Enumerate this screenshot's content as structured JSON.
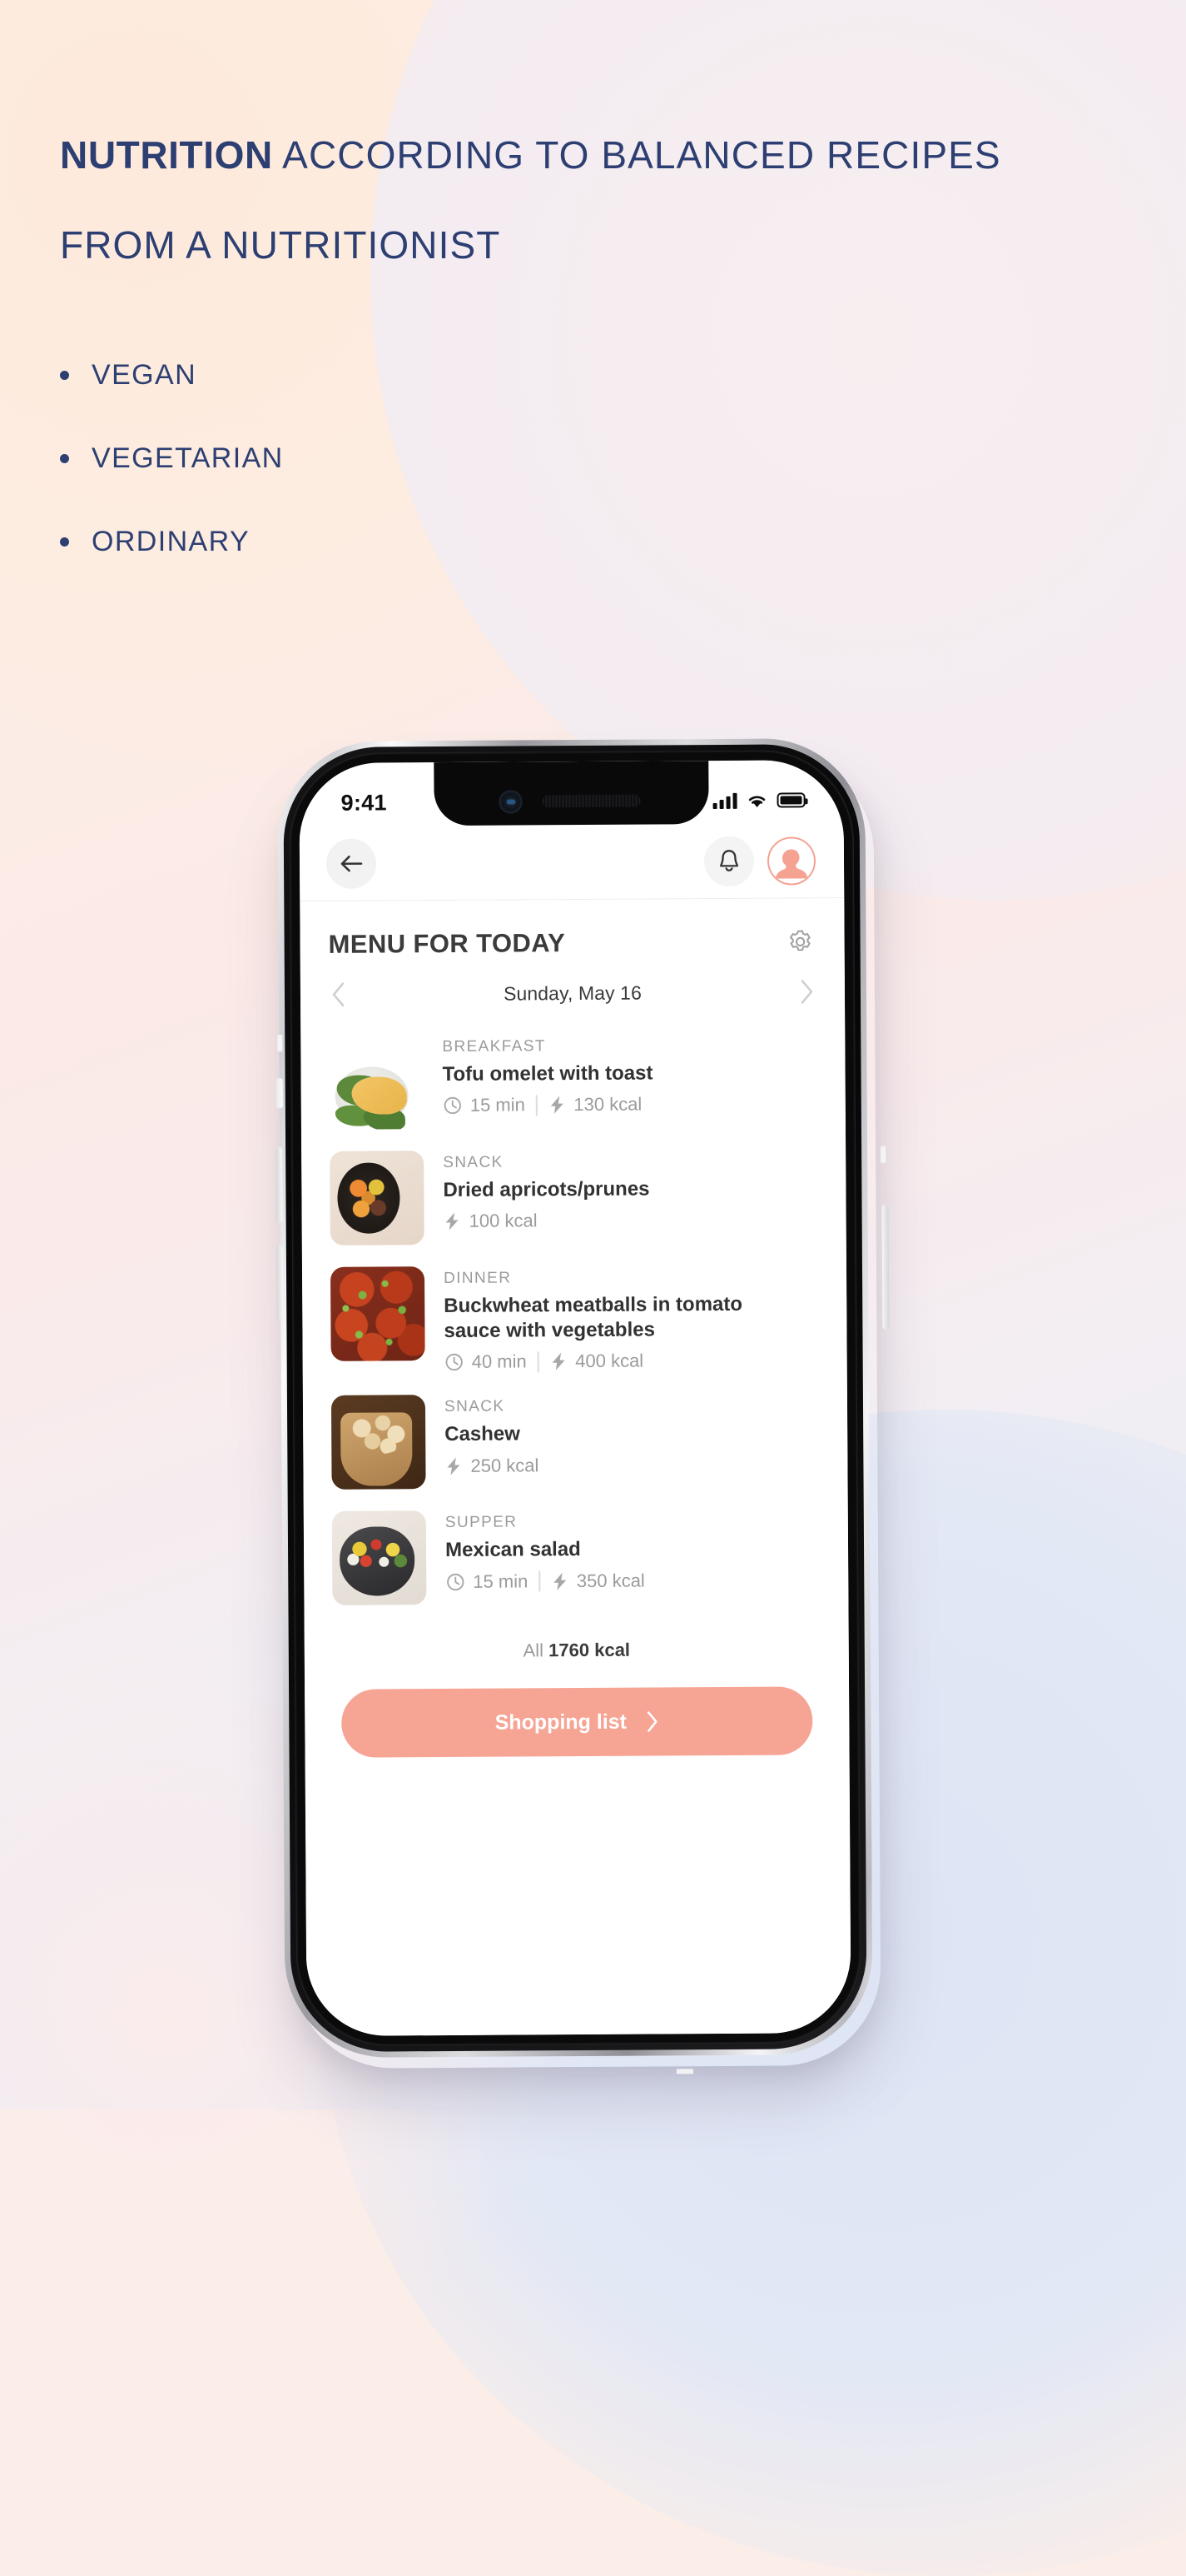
{
  "hero": {
    "headline_strong": "NUTRITION",
    "headline_rest": " ACCORDING TO BALANCED RECIPES FROM A NUTRITIONIST",
    "bullets": [
      "VEGAN",
      "VEGETARIAN",
      "ORDINARY"
    ],
    "accent_navy": "#2d3f72"
  },
  "phone": {
    "status_bar": {
      "time": "9:41",
      "signal_icon": "signal-bars-icon",
      "wifi_icon": "wifi-icon",
      "battery_icon": "battery-full-icon"
    },
    "nav": {
      "back_icon": "arrow-left-icon",
      "bell_icon": "bell-icon",
      "avatar_icon": "user-avatar-icon"
    },
    "screen": {
      "page_title": "MENU FOR TODAY",
      "settings_icon": "gear-icon",
      "date": "Sunday, May 16",
      "prev_icon": "chevron-left-icon",
      "next_icon": "chevron-right-icon",
      "meals": [
        {
          "category": "BREAKFAST",
          "name": "Tofu omelet with toast",
          "time": "15 min",
          "calories": "130 kcal",
          "thumb": "t-omelet"
        },
        {
          "category": "SNACK",
          "name": "Dried apricots/prunes",
          "time": "",
          "calories": "100 kcal",
          "thumb": "t-apricot"
        },
        {
          "category": "DINNER",
          "name": "Buckwheat meatballs in tomato sauce with vegetables",
          "time": "40 min",
          "calories": "400 kcal",
          "thumb": "t-meatball"
        },
        {
          "category": "SNACK",
          "name": "Cashew",
          "time": "",
          "calories": "250 kcal",
          "thumb": "t-cashew"
        },
        {
          "category": "SUPPER",
          "name": "Mexican salad",
          "time": "15 min",
          "calories": "350 kcal",
          "thumb": "t-mexican"
        }
      ],
      "total_prefix": "All",
      "total_value": "1760 kcal",
      "shopping_button": {
        "label": "Shopping list",
        "chevron_icon": "chevron-right-icon",
        "color": "#f6a494"
      }
    }
  }
}
